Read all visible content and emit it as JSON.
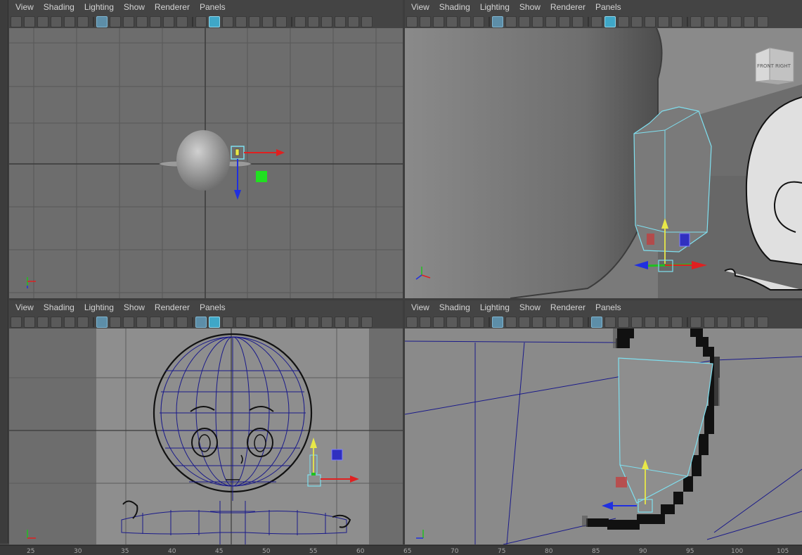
{
  "menus": [
    "View",
    "Shading",
    "Lighting",
    "Show",
    "Renderer",
    "Panels"
  ],
  "viewcube": {
    "front_label": "FRONT",
    "right_label": "RIGHT"
  },
  "timeline": {
    "ticks": [
      "25",
      "30",
      "35",
      "40",
      "45",
      "50",
      "55",
      "60",
      "65",
      "70",
      "75",
      "80",
      "85",
      "90",
      "95",
      "100",
      "105"
    ]
  },
  "colors": {
    "x_axis": "#e02020",
    "y_axis": "#e8e848",
    "z_axis": "#2030e0",
    "selection": "#7fe0f0",
    "wire": "#1a1a8a"
  }
}
